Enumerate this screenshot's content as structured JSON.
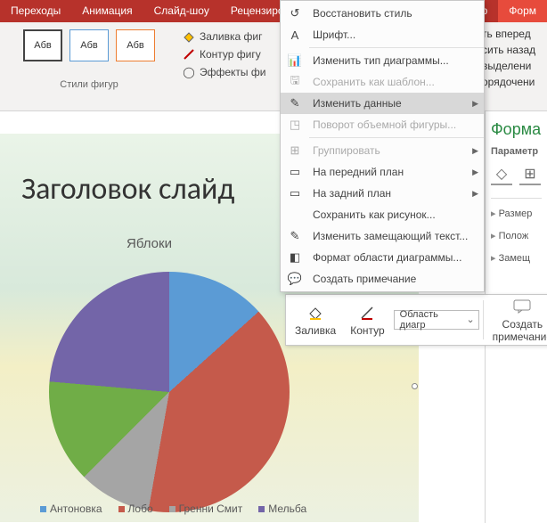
{
  "tabs": [
    "Переходы",
    "Анимация",
    "Слайд-шоу",
    "Рецензиров",
    "р",
    "Форм"
  ],
  "ribbon": {
    "style_label": "Абв",
    "group": "Стили фигур",
    "fill": "Заливка фиг",
    "outline": "Контур фигу",
    "effects": "Эффекты фи",
    "rc": [
      "ть вперед",
      "сить назад",
      "выделени",
      "орядочени"
    ]
  },
  "context": [
    {
      "icon": "↺",
      "label": "Восстановить стиль",
      "arrow": false
    },
    {
      "icon": "A",
      "label": "Шрифт...",
      "arrow": false
    },
    {
      "sep": true
    },
    {
      "icon": "📊",
      "label": "Изменить тип диаграммы...",
      "arrow": false
    },
    {
      "icon": "🖫",
      "label": "Сохранить как шаблон...",
      "arrow": false,
      "disabled": true
    },
    {
      "icon": "✎",
      "label": "Изменить данные",
      "arrow": true,
      "hover": true
    },
    {
      "icon": "◳",
      "label": "Поворот объемной фигуры...",
      "arrow": false,
      "disabled": true
    },
    {
      "sep": true
    },
    {
      "icon": "⊞",
      "label": "Группировать",
      "arrow": true,
      "disabled": true
    },
    {
      "icon": "▭",
      "label": "На передний план",
      "arrow": true
    },
    {
      "icon": "▭",
      "label": "На задний план",
      "arrow": true
    },
    {
      "icon": "",
      "label": "Сохранить как рисунок...",
      "arrow": false
    },
    {
      "icon": "✎",
      "label": "Изменить замещающий текст...",
      "arrow": false
    },
    {
      "icon": "◧",
      "label": "Формат области диаграммы...",
      "arrow": false
    },
    {
      "icon": "💬",
      "label": "Создать примечание",
      "arrow": false
    }
  ],
  "mini": {
    "fill": "Заливка",
    "outline": "Контур",
    "combo": "Область диагр",
    "note1": "Создать",
    "note2": "примечание"
  },
  "fmt": {
    "title": "Форма",
    "sub": "Параметр",
    "rows": [
      "Размер",
      "Полож",
      "Замещ"
    ]
  },
  "slide": {
    "title": "Заголовок слайд"
  },
  "chart_data": {
    "type": "pie",
    "title": "Яблоки",
    "series": [
      {
        "name": "Антоновка",
        "value": 13,
        "color": "#5b9bd5"
      },
      {
        "name": "Лобо",
        "value": 40,
        "color": "#c55a4b"
      },
      {
        "name": "Гренни Смит",
        "value": 10,
        "color": "#a5a5a5"
      },
      {
        "name": "",
        "value": 14,
        "color": "#70ad47"
      },
      {
        "name": "Мельба",
        "value": 23,
        "color": "#7365a8"
      }
    ]
  }
}
